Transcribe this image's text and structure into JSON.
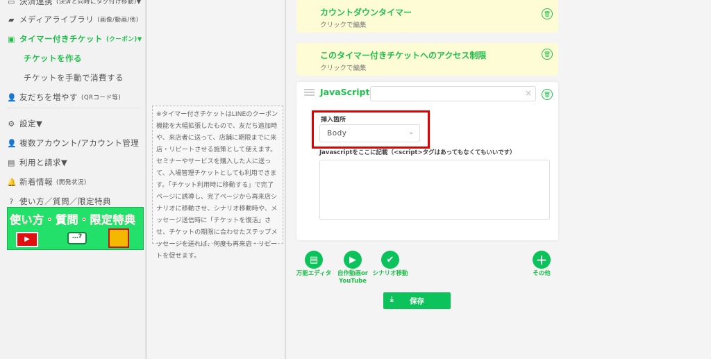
{
  "sidebar": {
    "items": [
      {
        "label": "決済連携",
        "note": "(決済と同時にタグ付け移動)▼",
        "icon": "card-icon"
      },
      {
        "label": "メディアライブラリ",
        "note": "(画像/動画/他)",
        "icon": "folder-icon"
      },
      {
        "label": "タイマー付きチケット",
        "note": "(クーポン)▼",
        "icon": "ticket-icon"
      },
      {
        "label": "チケットを作る"
      },
      {
        "label": "チケットを手動で消費する"
      },
      {
        "label": "友だちを増やす",
        "note": "(QRコード等)",
        "icon": "add-user-icon"
      },
      {
        "label": "設定▼",
        "icon": "gear-icon"
      },
      {
        "label": "複数アカウント/アカウント管理",
        "icon": "accounts-icon"
      },
      {
        "label": "利用と請求▼",
        "icon": "billing-icon"
      },
      {
        "label": "新着情報",
        "note": "(開発状況)",
        "icon": "bell-icon"
      },
      {
        "label": "使い方／質問／限定特典",
        "icon": "question-icon"
      }
    ],
    "banner": {
      "title": "使い方・質問・限定特典",
      "chat": "…?"
    }
  },
  "note": "※タイマー付きチケットはLINEのクーポン機能を大幅拡張したもので、友だち追加時や、来店者に送って、店舗に期限までに来店・リピートさせる施策として使えます。セミナーやサービスを購入した人に送って、入場管理チケットとしても利用できます。「チケット利用時に移動する」で完了ページに誘導し、完了ページから再来店シナリオに移動させ、シナリオ移動時や、メッセージ送信時に「チケットを復活」させ、チケットの期限に合わせたステップメッセージを送れば、何度も再来店・リピートを促せます。",
  "cards": [
    {
      "title": "カウントダウンタイマー",
      "sub": "クリックで編集"
    },
    {
      "title": "このタイマー付きチケットへのアクセス制限",
      "sub": "クリックで編集"
    }
  ],
  "js": {
    "title": "JavaScript",
    "name_value": "",
    "insert_label": "挿入箇所",
    "insert_value": "Body",
    "code_label": "Javascriptをここに記載（<script>タグはあってもなくてもいいです）",
    "code_value": ""
  },
  "actions": [
    {
      "label": "万能エディタ",
      "icon": "book-icon"
    },
    {
      "label": "自作動画or YouTube",
      "icon": "youtube-icon"
    },
    {
      "label": "シナリオ移動",
      "icon": "check-icon"
    },
    {
      "label": "その他",
      "icon": "plus-icon"
    }
  ],
  "save_label": "保存",
  "highlight_color": "#e00000",
  "accent_color": "#1fbf4c"
}
